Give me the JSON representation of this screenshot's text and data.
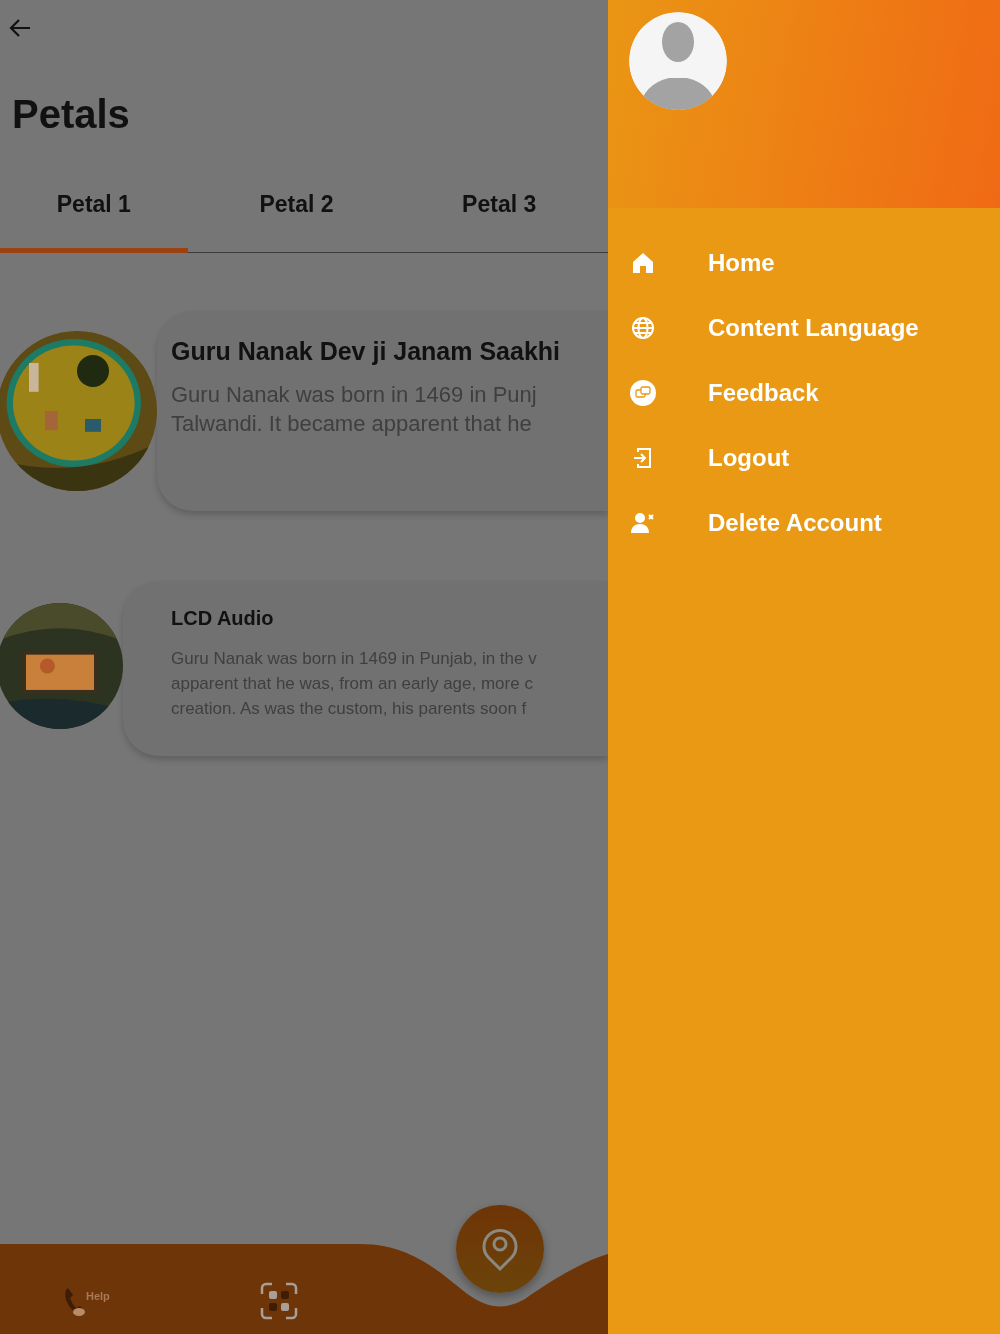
{
  "page": {
    "title": "Petals"
  },
  "tabs": [
    {
      "label": "Petal 1",
      "selected": true
    },
    {
      "label": "Petal 2",
      "selected": false
    },
    {
      "label": "Petal 3",
      "selected": false
    }
  ],
  "cards": [
    {
      "title": "Guru Nanak Dev ji Janam Saakhi",
      "kind": "large",
      "lines": [
        "Guru Nanak was born in 1469 in Punj",
        "Talwandi. It became apparent that he"
      ]
    },
    {
      "title": "LCD Audio",
      "kind": "small",
      "lines": [
        "Guru Nanak was born in 1469 in Punjab, in the v",
        "apparent that he was, from an early age, more c",
        "creation. As was the custom, his parents soon f"
      ]
    }
  ],
  "bottom_nav": {
    "help_label": "Help"
  },
  "drawer": {
    "items": [
      {
        "kind": "home",
        "label": "Home"
      },
      {
        "kind": "language",
        "label": "Content Language"
      },
      {
        "kind": "feedback",
        "label": "Feedback"
      },
      {
        "kind": "logout",
        "label": "Logout"
      },
      {
        "kind": "delete",
        "label": "Delete Account"
      }
    ]
  }
}
